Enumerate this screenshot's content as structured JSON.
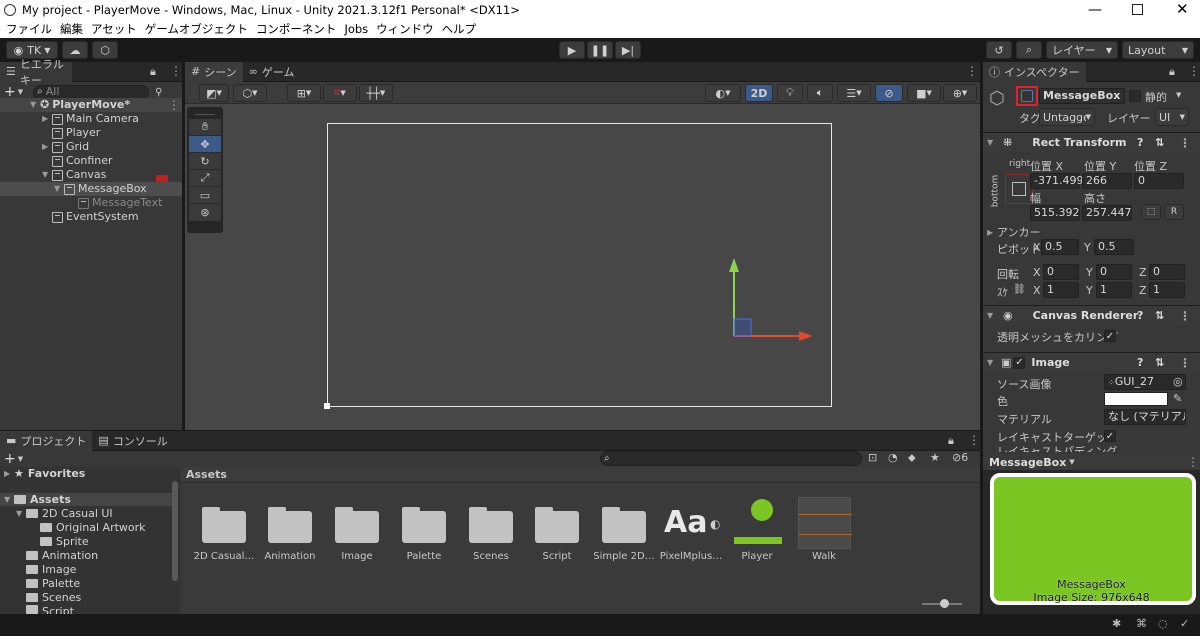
{
  "window": {
    "title": "My project - PlayerMove - Windows, Mac, Linux - Unity 2021.3.12f1 Personal* <DX11>"
  },
  "menu": [
    "ファイル",
    "編集",
    "アセット",
    "ゲームオブジェクト",
    "コンポーネント",
    "Jobs",
    "ウィンドウ",
    "ヘルプ"
  ],
  "toolbar": {
    "account": "TK",
    "layers": "レイヤー",
    "layout": "Layout"
  },
  "hierarchy": {
    "tab": "ヒエラルキー",
    "search_placeholder": "All",
    "scene": "PlayerMove*",
    "items": [
      {
        "label": "Main Camera"
      },
      {
        "label": "Player"
      },
      {
        "label": "Grid"
      },
      {
        "label": "Confiner"
      },
      {
        "label": "Canvas"
      },
      {
        "label": "MessageBox"
      },
      {
        "label": "MessageText"
      },
      {
        "label": "EventSystem"
      }
    ]
  },
  "scene_view": {
    "tabs": [
      "シーン",
      "ゲーム"
    ],
    "mode_2d": "2D"
  },
  "inspector": {
    "tab": "インスペクター",
    "object_name": "MessageBox",
    "static_label": "静的",
    "tag_label": "タグ",
    "tag_value": "Untagged",
    "layer_label": "レイヤー",
    "layer_value": "UI",
    "rect_transform": {
      "title": "Rect Transform",
      "anchor_h": "right",
      "anchor_v": "bottom",
      "pos_x_label": "位置 X",
      "pos_y_label": "位置 Y",
      "pos_z_label": "位置 Z",
      "pos_x": "-371.499",
      "pos_y": "266",
      "pos_z": "0",
      "width_label": "幅",
      "height_label": "高さ",
      "width": "515.3928",
      "height": "257.4473",
      "r_button": "R",
      "anchors_label": "アンカー",
      "pivot_label": "ピボット",
      "pivot_x_label": "X",
      "pivot_x": "0.5",
      "pivot_y_label": "Y",
      "pivot_y": "0.5",
      "rotation_label": "回転",
      "rot_x": "0",
      "rot_y": "0",
      "rot_z": "0",
      "scale_label": "ｽｹ",
      "scale_x": "1",
      "scale_y": "1",
      "scale_z": "1",
      "axis_x": "X",
      "axis_y": "Y",
      "axis_z": "Z"
    },
    "canvas_renderer": {
      "title": "Canvas Renderer",
      "cull_label": "透明メッシュをカリング"
    },
    "image": {
      "title": "Image",
      "source_label": "ソース画像",
      "source_value": "GUI_27",
      "color_label": "色",
      "material_label": "マテリアル",
      "material_value": "なし (マテリアル",
      "raycast_label": "レイキャストターゲット",
      "cut_label": "レイキャストパディング"
    },
    "preview": {
      "title": "MessageBox",
      "caption": "MessageBox",
      "size": "Image Size: 976x648",
      "fill_color": "#7bc623",
      "border_color": "#ffffff"
    }
  },
  "project": {
    "tabs": [
      "プロジェクト",
      "コンソール"
    ],
    "favorites": "Favorites",
    "assets_root": "Assets",
    "tree": [
      {
        "label": "2D Casual UI"
      },
      {
        "label": "Original Artwork"
      },
      {
        "label": "Sprite"
      },
      {
        "label": "Animation"
      },
      {
        "label": "Image"
      },
      {
        "label": "Palette"
      },
      {
        "label": "Scenes"
      },
      {
        "label": "Script"
      }
    ],
    "breadcrumb": "Assets",
    "hidden_count": "6",
    "assets": [
      {
        "label": "2D Casual…",
        "kind": "folder"
      },
      {
        "label": "Animation",
        "kind": "folder"
      },
      {
        "label": "Image",
        "kind": "folder"
      },
      {
        "label": "Palette",
        "kind": "folder"
      },
      {
        "label": "Scenes",
        "kind": "folder"
      },
      {
        "label": "Script",
        "kind": "folder"
      },
      {
        "label": "Simple 2D…",
        "kind": "folder"
      },
      {
        "label": "PixelMplus…",
        "kind": "font",
        "glyph": "Aa"
      },
      {
        "label": "Player",
        "kind": "sprite"
      },
      {
        "label": "Walk",
        "kind": "anim"
      }
    ]
  },
  "colors": {
    "accent": "#3b5a8a",
    "gizmo_y": "#8fd14f",
    "gizmo_x": "#e04a2e",
    "selection": "#2c5d87",
    "highlight_box": "#e0202a"
  }
}
